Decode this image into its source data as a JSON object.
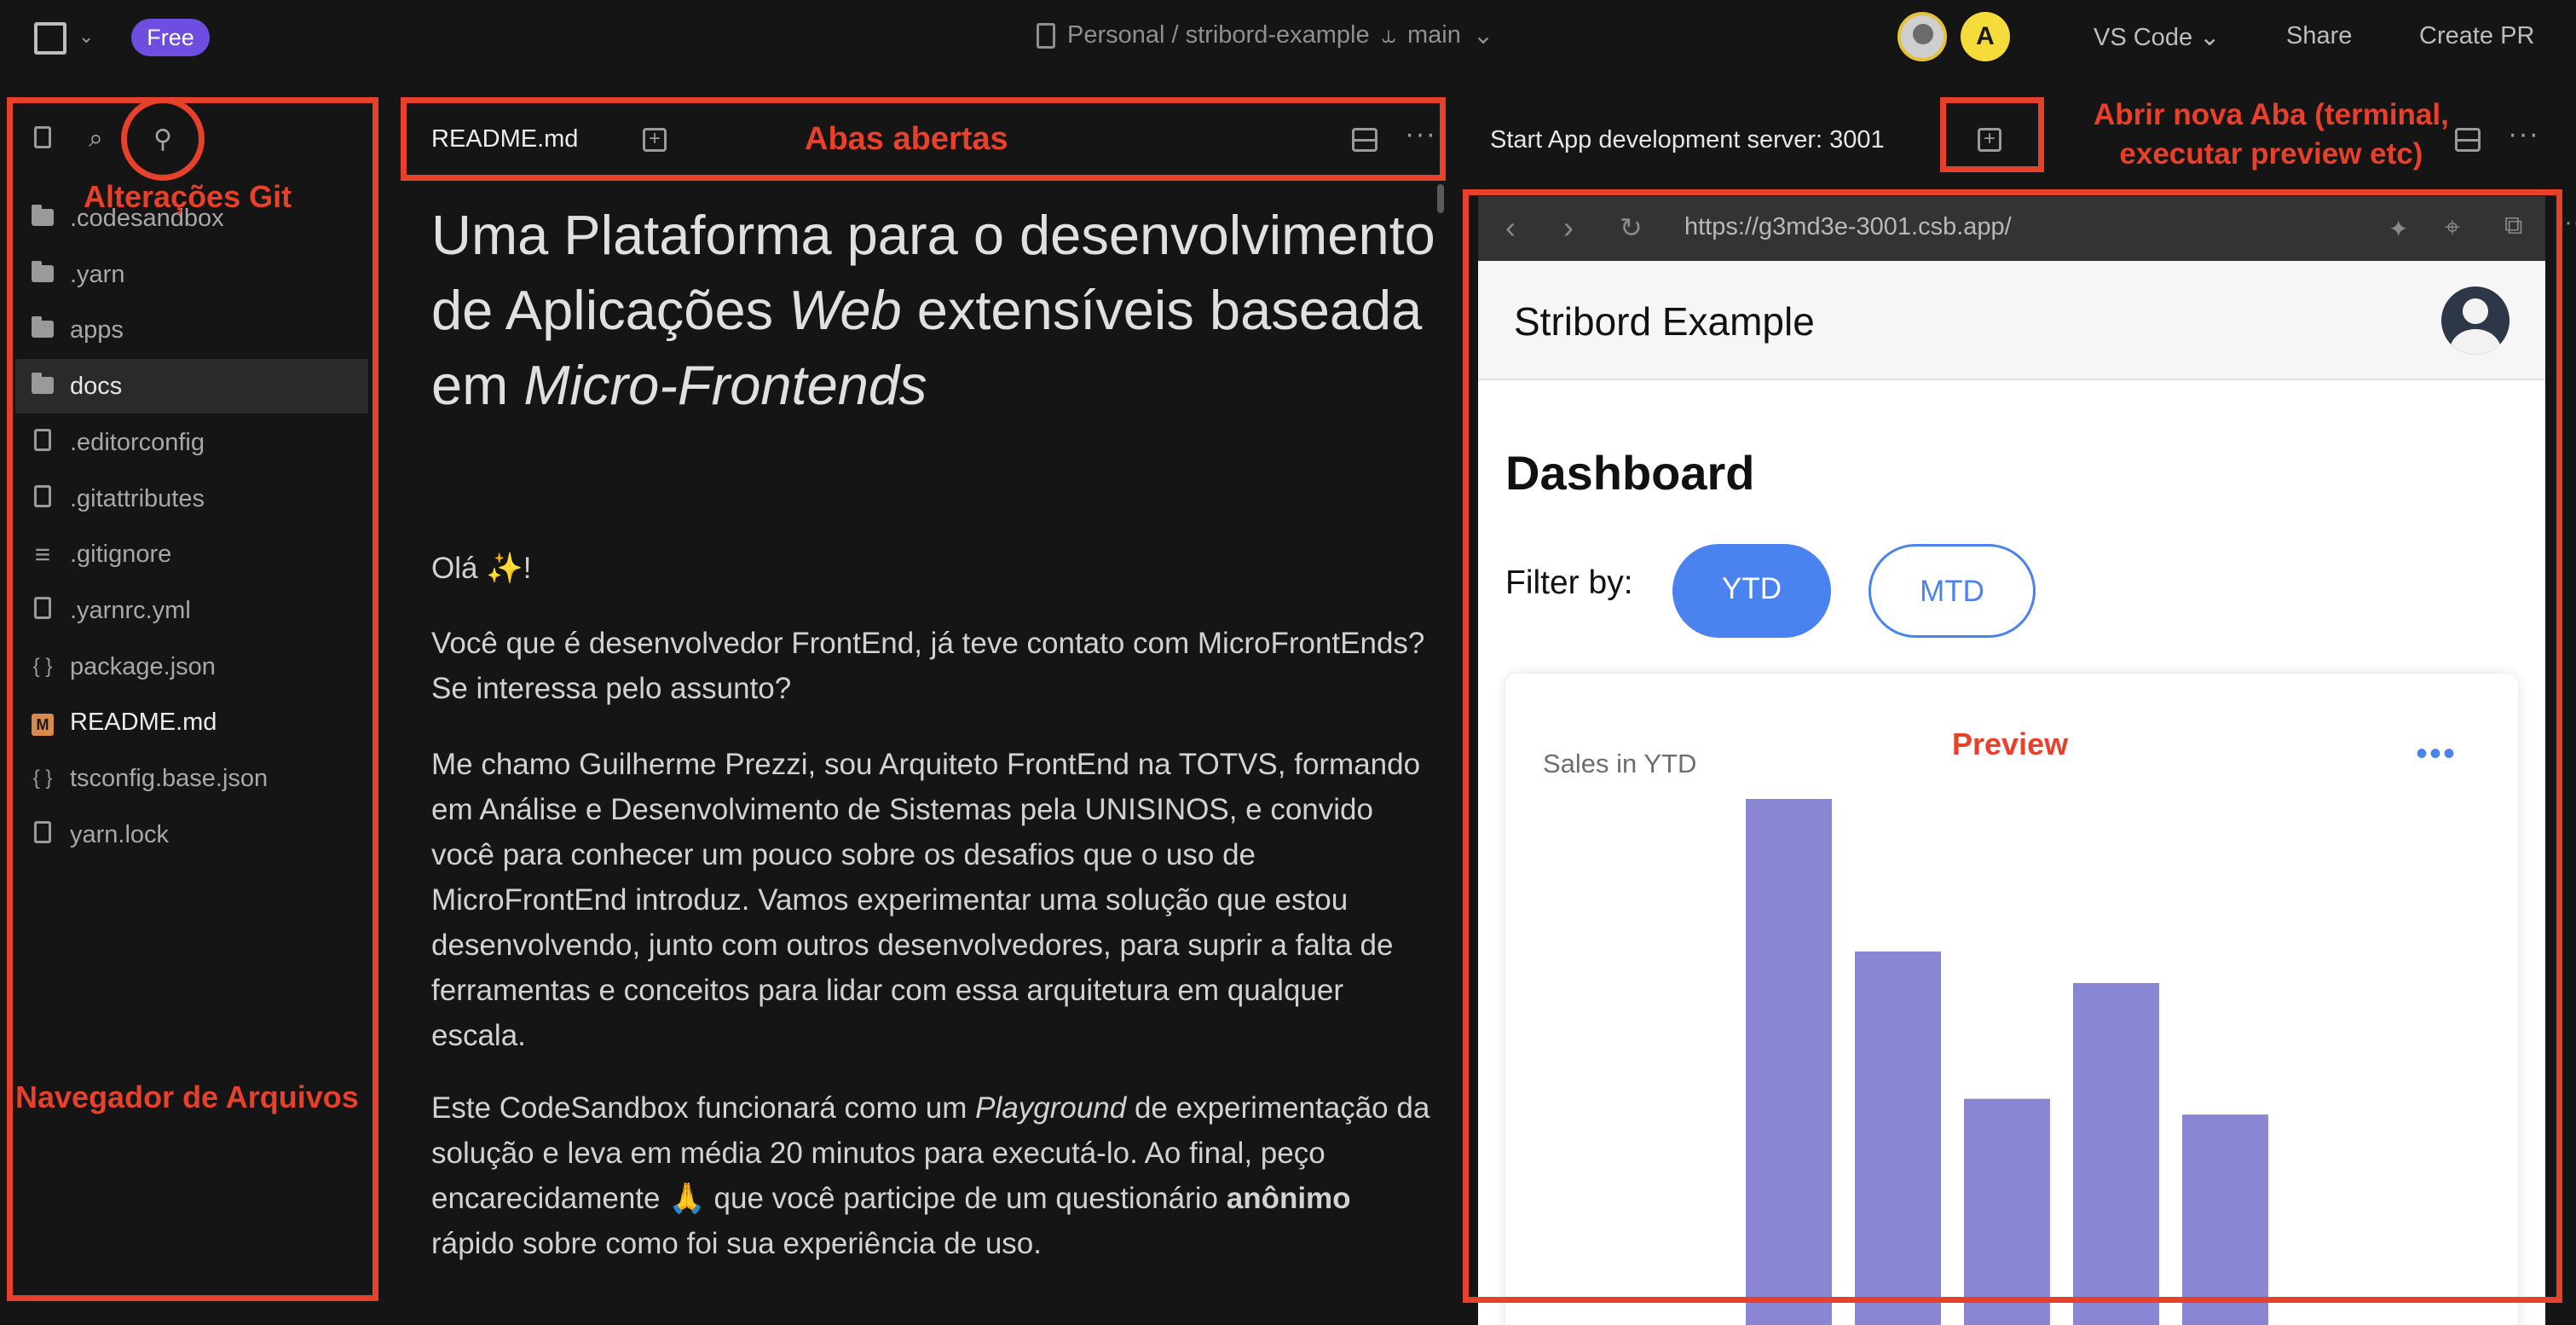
{
  "topbar": {
    "plan_badge": "Free",
    "breadcrumb": "Personal / stribord-example",
    "branch": "main",
    "avatar_initial": "A",
    "editor_menu": "VS Code",
    "share_label": "Share",
    "create_pr_label": "Create PR"
  },
  "sidebar": {
    "files": [
      {
        "name": ".codesandbox",
        "type": "folder"
      },
      {
        "name": ".yarn",
        "type": "folder"
      },
      {
        "name": "apps",
        "type": "folder"
      },
      {
        "name": "docs",
        "type": "folder"
      },
      {
        "name": ".editorconfig",
        "type": "file"
      },
      {
        "name": ".gitattributes",
        "type": "file"
      },
      {
        "name": ".gitignore",
        "type": "lines"
      },
      {
        "name": ".yarnrc.yml",
        "type": "file"
      },
      {
        "name": "package.json",
        "type": "json"
      },
      {
        "name": "README.md",
        "type": "markdown"
      },
      {
        "name": "tsconfig.base.json",
        "type": "json"
      },
      {
        "name": "yarn.lock",
        "type": "file"
      }
    ]
  },
  "editor": {
    "tab_label": "README.md",
    "title_part1": "Uma Plataforma para o desenvolvimento de Aplicações ",
    "title_em1": "Web",
    "title_part2": " extensíveis baseada em ",
    "title_em2": "Micro-Frontends",
    "p1": "Olá ✨!",
    "p2": "Você que é desenvolvedor FrontEnd, já teve contato com MicroFrontEnds? Se interessa pelo assunto?",
    "p3": "Me chamo Guilherme Prezzi, sou Arquiteto FrontEnd na TOTVS, formando em Análise e Desenvolvimento de Sistemas pela UNISINOS, e convido você para conhecer um pouco sobre os desafios que o uso de MicroFrontEnd introduz. Vamos experimentar uma solução que estou desenvolvendo, junto com outros desenvolvedores, para suprir a falta de ferramentas e conceitos para lidar com essa arquitetura em qualquer escala.",
    "p4_a": "Este CodeSandbox funcionará como um ",
    "p4_em": "Playground",
    "p4_b": " de experimentação da solução e leva em média 20 minutos para executá-lo. Ao final, peço encarecidamente 🙏 que você participe de um questionário ",
    "p4_strong": "anônimo",
    "p4_c": " rápido sobre como foi sua experiência de uso."
  },
  "preview": {
    "run_tab_label": "Start App development server: 3001",
    "url": "https://g3md3e-3001.csb.app/",
    "app_title": "Stribord Example",
    "dashboard_title": "Dashboard",
    "filter_label": "Filter by:",
    "filter_options": [
      "YTD",
      "MTD"
    ],
    "selected_filter": "YTD",
    "card_title": "Sales in YTD"
  },
  "chart_data": {
    "type": "bar",
    "title": "Sales in YTD",
    "values": [
      100,
      71,
      43,
      65,
      40
    ],
    "bar_color": "#8a86d4"
  },
  "annotations": {
    "git": "Alterações Git",
    "tabs": "Abas abertas",
    "new_tab_line1": "Abrir nova Aba (terminal,",
    "new_tab_line2": "executar preview etc)",
    "file_nav": "Navegador de Arquivos",
    "preview": "Preview"
  },
  "colors": {
    "annotation": "#e7402b",
    "accent": "#4a82f0",
    "badge": "#6d4ee0"
  }
}
